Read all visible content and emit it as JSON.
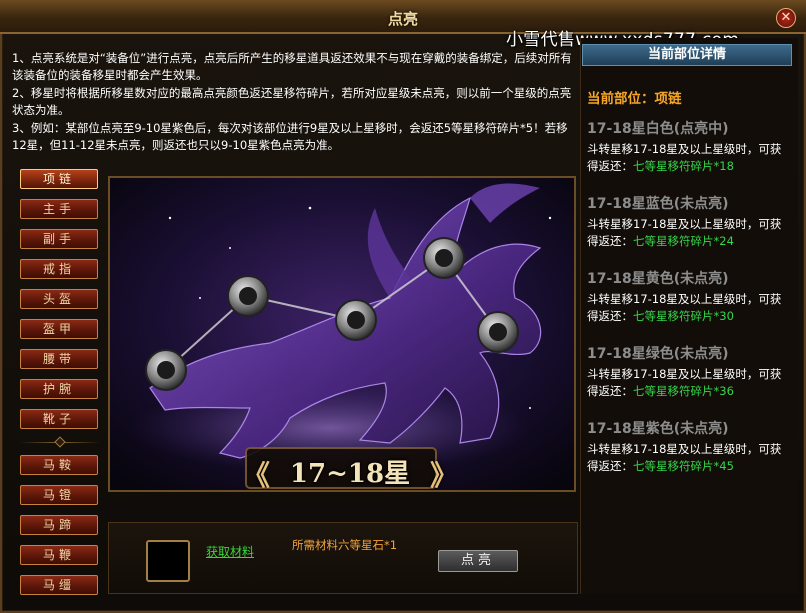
{
  "window": {
    "title": "点亮",
    "close_glyph": "✕"
  },
  "watermark": "小雪代售www.xxds777.com",
  "description": [
    "1、点亮系统是对“装备位”进行点亮，点亮后所产生的移星道具返还效果不与现在穿戴的装备绑定，后续对所有该装备位的装备移星时都会产生效果。",
    "2、移星时将根据所移星数对应的最高点亮颜色返还星移符碎片，若所对应星级未点亮，则以前一个星级的点亮状态为准。",
    "3、例如：某部位点亮至9-10星紫色后，每次对该部位进行9星及以上星移时，会返还5等星移符碎片*5！若移12星，但11-12星未点亮，则返还也只以9-10星紫色点亮为准。"
  ],
  "nav": {
    "items": [
      "项链",
      "主手",
      "副手",
      "戒指",
      "头盔",
      "盔甲",
      "腰带",
      "护腕",
      "靴子",
      "马鞍",
      "马镫",
      "马蹄",
      "马鞭",
      "马缰"
    ],
    "active_index": 0
  },
  "art": {
    "star_range": "17~18星",
    "left_arrow": "《",
    "right_arrow": "》",
    "nodes": 5
  },
  "bottom": {
    "get_material": "获取材料",
    "required_material": "所需材料六等星石*1",
    "light_button": "点亮"
  },
  "right_panel": {
    "header": "当前部位详情",
    "current_part": "当前部位：项链",
    "entries": [
      {
        "title": "17-18星白色(点亮中)",
        "line1": "斗转星移17-18星及以上星级时，可获",
        "line2_prefix": "得返还：",
        "reward": "七等星移符碎片*18"
      },
      {
        "title": "17-18星蓝色(未点亮)",
        "line1": "斗转星移17-18星及以上星级时，可获",
        "line2_prefix": "得返还：",
        "reward": "七等星移符碎片*24"
      },
      {
        "title": "17-18星黄色(未点亮)",
        "line1": "斗转星移17-18星及以上星级时，可获",
        "line2_prefix": "得返还：",
        "reward": "七等星移符碎片*30"
      },
      {
        "title": "17-18星绿色(未点亮)",
        "line1": "斗转星移17-18星及以上星级时，可获",
        "line2_prefix": "得返还：",
        "reward": "七等星移符碎片*36"
      },
      {
        "title": "17-18星紫色(未点亮)",
        "line1": "斗转星移17-18星及以上星级时，可获",
        "line2_prefix": "得返还：",
        "reward": "七等星移符碎片*45"
      }
    ]
  },
  "colors": {
    "title_gold": "#f1d9a0",
    "reward_green": "#35d54a",
    "current_orange": "#f7a628",
    "entry_gray": "#8d8d8d"
  }
}
